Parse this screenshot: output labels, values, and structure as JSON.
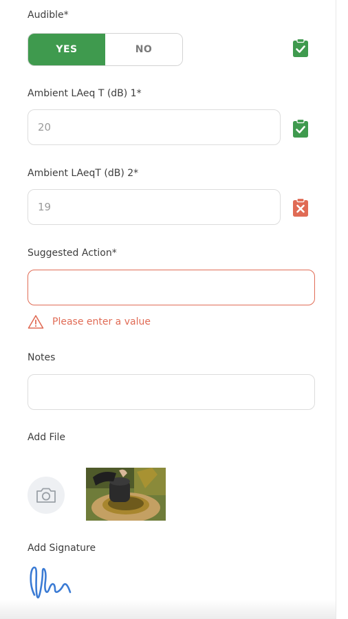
{
  "colors": {
    "success": "#3f9a4e",
    "error": "#e06b55",
    "signature": "#3b7bd4"
  },
  "audible": {
    "label": "Audible*",
    "yes_label": "YES",
    "no_label": "NO",
    "selected": "YES",
    "status_icon": "clipboard-check-icon"
  },
  "ambient1": {
    "label": "Ambient LAeq T (dB) 1*",
    "value": "20",
    "status_icon": "clipboard-check-icon"
  },
  "ambient2": {
    "label": "Ambient LAeqT (dB) 2*",
    "value": "19",
    "status_icon": "clipboard-x-icon"
  },
  "suggested_action": {
    "label": "Suggested Action*",
    "value": "",
    "error": "Please enter a value",
    "error_icon": "warning-triangle-icon"
  },
  "notes": {
    "label": "Notes",
    "value": ""
  },
  "add_file": {
    "label": "Add File",
    "camera_icon": "camera-icon"
  },
  "signature": {
    "label": "Add Signature"
  }
}
